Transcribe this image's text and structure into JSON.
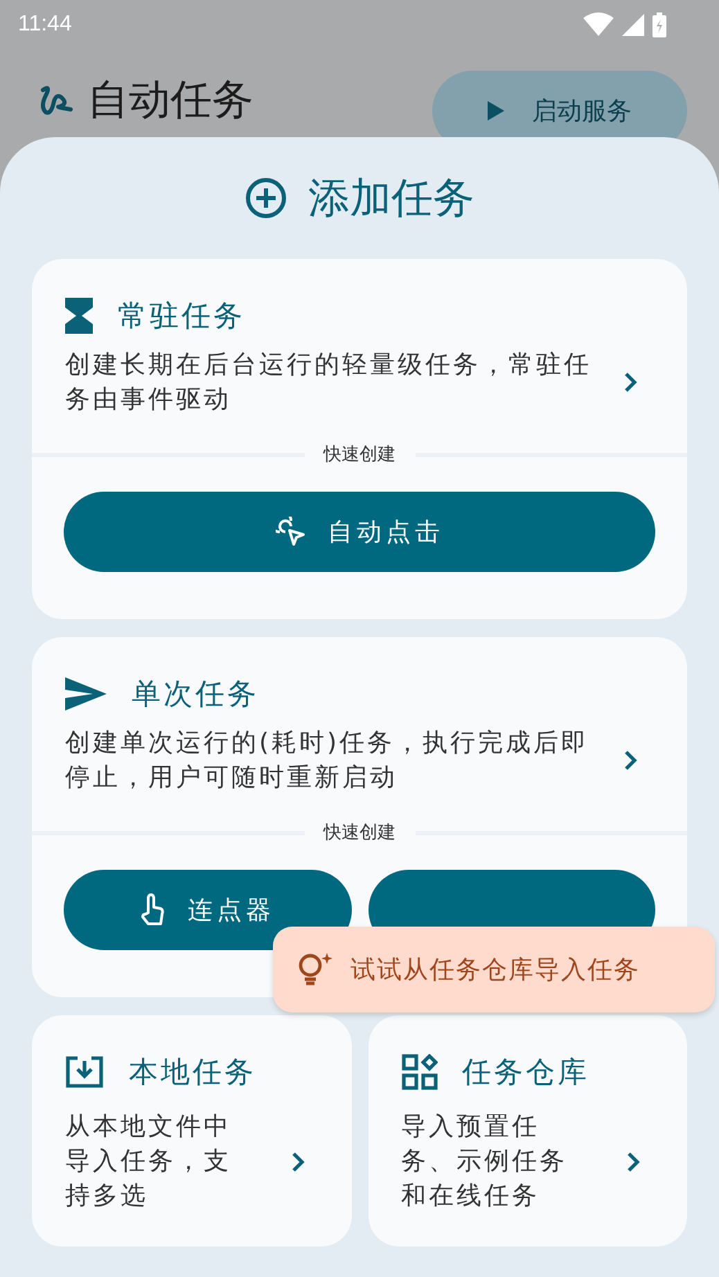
{
  "status_bar": {
    "time": "11:44"
  },
  "header": {
    "title": "自动任务",
    "start_button": "启动服务"
  },
  "sheet": {
    "title": "添加任务",
    "cards": [
      {
        "kind": "resident",
        "title": "常驻任务",
        "description": "创建长期在后台运行的轻量级任务，常驻任务由事件驱动",
        "quick_label": "快速创建",
        "actions": [
          {
            "kind": "click",
            "label": "自动点击"
          }
        ]
      },
      {
        "kind": "single",
        "title": "单次任务",
        "description": "创建单次运行的(耗时)任务，执行完成后即停止，用户可随时重新启动",
        "quick_label": "快速创建",
        "actions": [
          {
            "kind": "tap",
            "label": "连点器"
          },
          {
            "kind": "gesture"
          }
        ]
      }
    ],
    "bottom_cards": [
      {
        "kind": "local",
        "title": "本地任务",
        "description": "从本地文件中导入任务，支持多选"
      },
      {
        "kind": "repo",
        "title": "任务仓库",
        "description": "导入预置任务、示例任务和在线任务"
      }
    ],
    "tooltip": "试试从任务仓库导入任务"
  }
}
